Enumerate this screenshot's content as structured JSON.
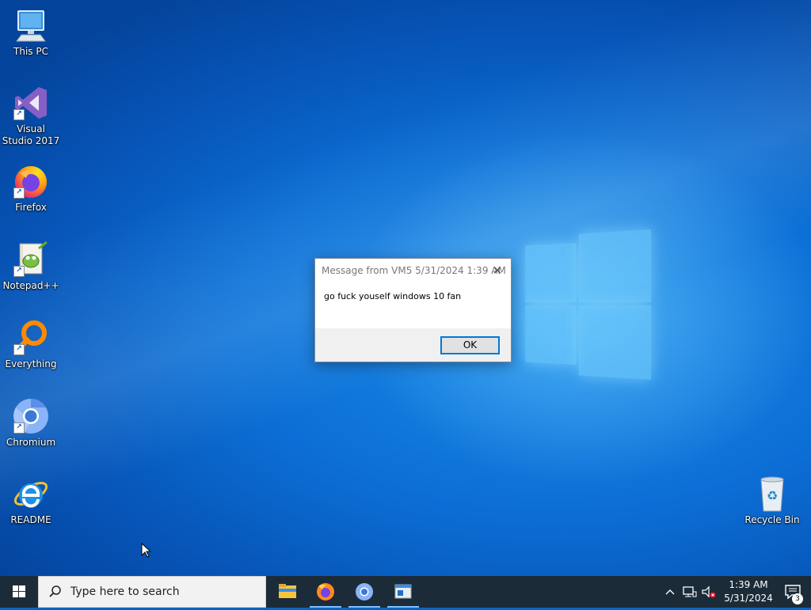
{
  "desktop": {
    "icons": [
      {
        "label": "This PC"
      },
      {
        "label": "Visual Studio 2017"
      },
      {
        "label": "Firefox"
      },
      {
        "label": "Notepad++"
      },
      {
        "label": "Everything"
      },
      {
        "label": "Chromium"
      },
      {
        "label": "README"
      },
      {
        "label": "Recycle Bin"
      }
    ]
  },
  "dialog": {
    "title": "Message from VM5 5/31/2024 1:39 AM",
    "message": "go fuck youself windows 10 fan",
    "ok_label": "OK",
    "close_icon": "close-icon"
  },
  "taskbar": {
    "search_placeholder": "Type here to search",
    "apps": [
      "file-explorer-icon",
      "firefox-icon",
      "chromium-icon",
      "message-window-icon"
    ],
    "clock": {
      "time": "1:39 AM",
      "date": "5/31/2024"
    },
    "notification_count": "3"
  },
  "colors": {
    "taskbar": "#1c2b38",
    "accent": "#0078d7",
    "wallpaper": "#0c6fd6"
  }
}
